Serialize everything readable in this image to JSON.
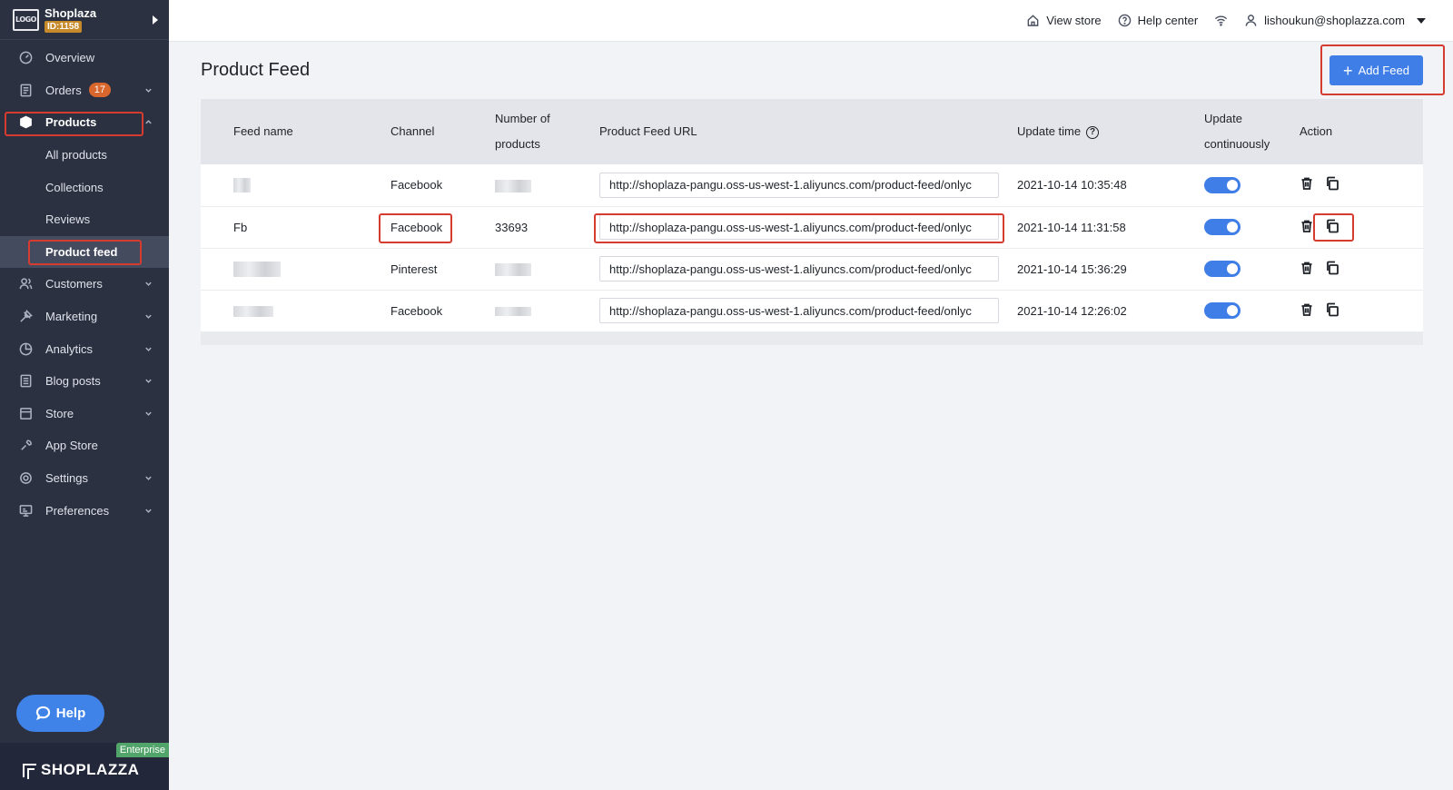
{
  "brand": {
    "logo_text": "LOGO",
    "name": "Shoplaza",
    "id": "ID:1158"
  },
  "sidebar": {
    "items": [
      {
        "label": "Overview",
        "icon": "overview-icon"
      },
      {
        "label": "Orders",
        "icon": "orders-icon",
        "badge": "17"
      },
      {
        "label": "Products",
        "icon": "products-icon"
      },
      {
        "label": "Customers",
        "icon": "customers-icon"
      },
      {
        "label": "Marketing",
        "icon": "marketing-icon"
      },
      {
        "label": "Analytics",
        "icon": "analytics-icon"
      },
      {
        "label": "Blog posts",
        "icon": "blog-icon"
      },
      {
        "label": "Store",
        "icon": "store-icon"
      },
      {
        "label": "App Store",
        "icon": "app-store-icon"
      },
      {
        "label": "Settings",
        "icon": "settings-icon"
      },
      {
        "label": "Preferences",
        "icon": "preferences-icon"
      }
    ],
    "product_sub": [
      "All products",
      "Collections",
      "Reviews",
      "Product feed"
    ],
    "help_label": "Help",
    "enterprise_label": "Enterprise",
    "footer_brand": "SHOPLAZZA"
  },
  "topbar": {
    "view_store": "View store",
    "help_center": "Help center",
    "user_email": "lishoukun@shoplazza.com"
  },
  "page": {
    "title": "Product Feed",
    "add_button": "Add Feed"
  },
  "table": {
    "headers": {
      "feed_name": "Feed name",
      "channel": "Channel",
      "num_products_1": "Number of",
      "num_products_2": "products",
      "url": "Product Feed URL",
      "update_time": "Update time",
      "update_cont_1": "Update",
      "update_cont_2": "continuously",
      "action": "Action"
    },
    "rows": [
      {
        "feed_name": "",
        "channel": "Facebook",
        "products": "",
        "url": "http://shoplaza-pangu.oss-us-west-1.aliyuncs.com/product-feed/onlyc",
        "update_time": "2021-10-14 10:35:48",
        "continuous": true
      },
      {
        "feed_name": "Fb",
        "channel": "Facebook",
        "products": "33693",
        "url": "http://shoplaza-pangu.oss-us-west-1.aliyuncs.com/product-feed/onlyc",
        "update_time": "2021-10-14 11:31:58",
        "continuous": true
      },
      {
        "feed_name": "",
        "channel": "Pinterest",
        "products": "",
        "url": "http://shoplaza-pangu.oss-us-west-1.aliyuncs.com/product-feed/onlyc",
        "update_time": "2021-10-14 15:36:29",
        "continuous": true
      },
      {
        "feed_name": "",
        "channel": "Facebook",
        "products": "",
        "url": "http://shoplaza-pangu.oss-us-west-1.aliyuncs.com/product-feed/onlyc",
        "update_time": "2021-10-14 12:26:02",
        "continuous": true
      }
    ]
  },
  "colors": {
    "sidebar_bg": "#2c3142",
    "accent": "#3f7ee6",
    "highlight": "#d63b2f",
    "badge": "#d9662c"
  }
}
